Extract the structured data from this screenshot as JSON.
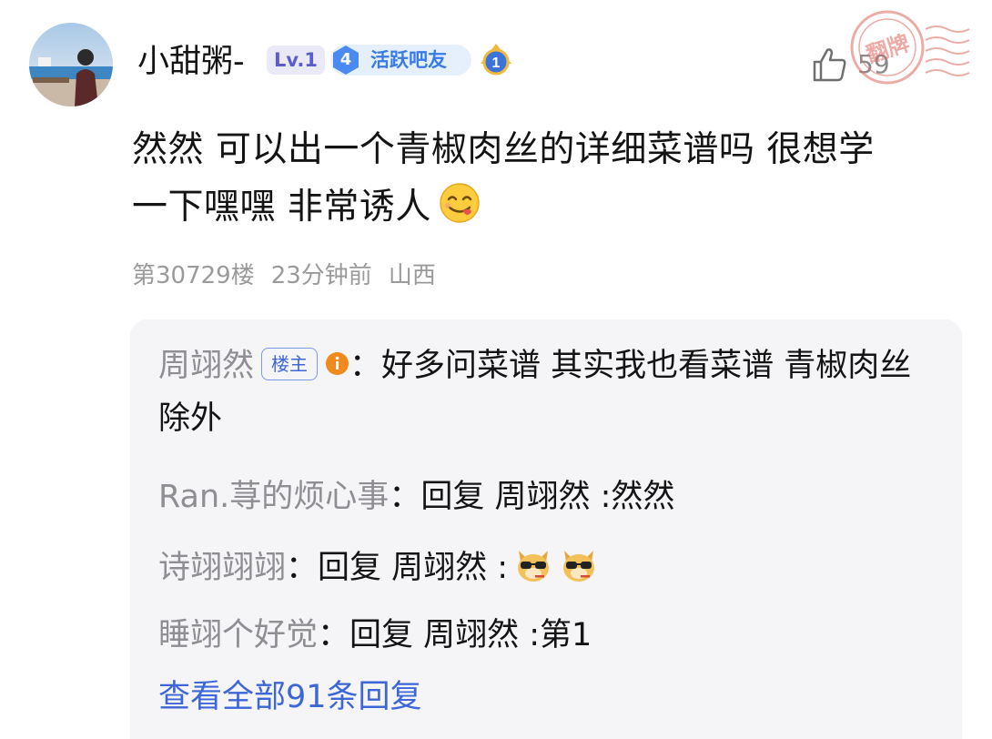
{
  "post": {
    "user": {
      "name": "小甜粥-",
      "level": "Lv.1",
      "active_level": "4",
      "active_title": "活跃吧友",
      "rank_number": "1",
      "avatar_icon": "user-avatar-photo"
    },
    "likes": "59",
    "stamp_text": "翻牌",
    "text_line1": "然然 可以出一个青椒肉丝的详细菜谱吗 很想学",
    "text_line2": "一下嘿嘿 非常诱人",
    "emoji": "yum-face-emoji",
    "meta": {
      "floor": "第30729楼",
      "time": "23分钟前",
      "location": "山西"
    }
  },
  "replies": [
    {
      "author": "周翊然",
      "host_tag": "楼主",
      "text": "：好多问菜谱 其实我也看菜谱 青椒肉丝除外"
    },
    {
      "author": "Ran.荨的烦心事",
      "text": "：回复 周翊然 :然然"
    },
    {
      "author": "诗翊翊翊",
      "text": "：回复 周翊然 :"
    },
    {
      "author": "睡翊个好觉",
      "text": "：回复 周翊然 :第1"
    }
  ],
  "view_all_label": "查看全部91条回复",
  "colors": {
    "link_blue": "#3d66d6",
    "muted_gray": "#8e8e93",
    "reply_bg": "#f5f5f7",
    "level_purple": "#5d5ccc",
    "active_blue": "#3a7be6"
  }
}
